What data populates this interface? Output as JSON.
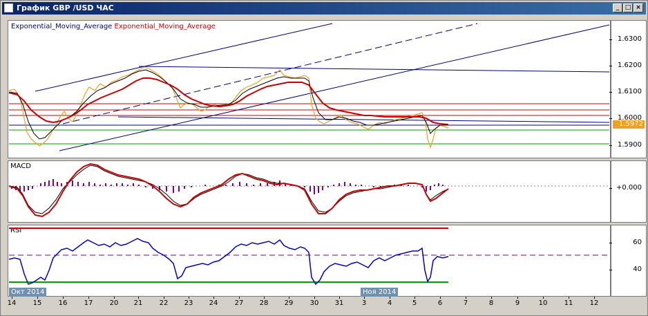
{
  "window": {
    "title": "График GBP /USD ЧАС",
    "minimize_glyph": "_",
    "maximize_glyph": "□",
    "close_glyph": "×"
  },
  "price_panel": {
    "legend_primary": "Exponential_Moving_Average",
    "legend_secondary": "Exponential_Moving_Average",
    "legend_primary_color": "#000080",
    "legend_secondary_color": "#cc0000",
    "current_price": "1.5972",
    "y_labels": [
      "1.6300",
      "1.6200",
      "1.6100",
      "1.6000",
      "1.5900"
    ]
  },
  "macd_panel": {
    "label": "MACD",
    "y_labels": [
      "+0.000"
    ]
  },
  "rsi_panel": {
    "label": "RSI",
    "y_labels": [
      "60",
      "40"
    ]
  },
  "x_axis": {
    "labels": [
      "14",
      "15",
      "16",
      "17",
      "20",
      "21",
      "22",
      "23",
      "24",
      "27",
      "28",
      "29",
      "30",
      "31",
      "3",
      "4",
      "5",
      "6",
      "7",
      "8",
      "9",
      "10",
      "11",
      "12"
    ],
    "month_markers": [
      "Окт 2014",
      "Ноя 2014"
    ]
  },
  "colors": {
    "price_line": "#f0a020",
    "ema_fast": "#000000",
    "ema_slow": "#cc0000",
    "channel": "#000080",
    "level_red": "#cc0000",
    "level_green": "#00a000",
    "macd_hist": "#800080",
    "rsi_line": "#0000cc"
  }
}
